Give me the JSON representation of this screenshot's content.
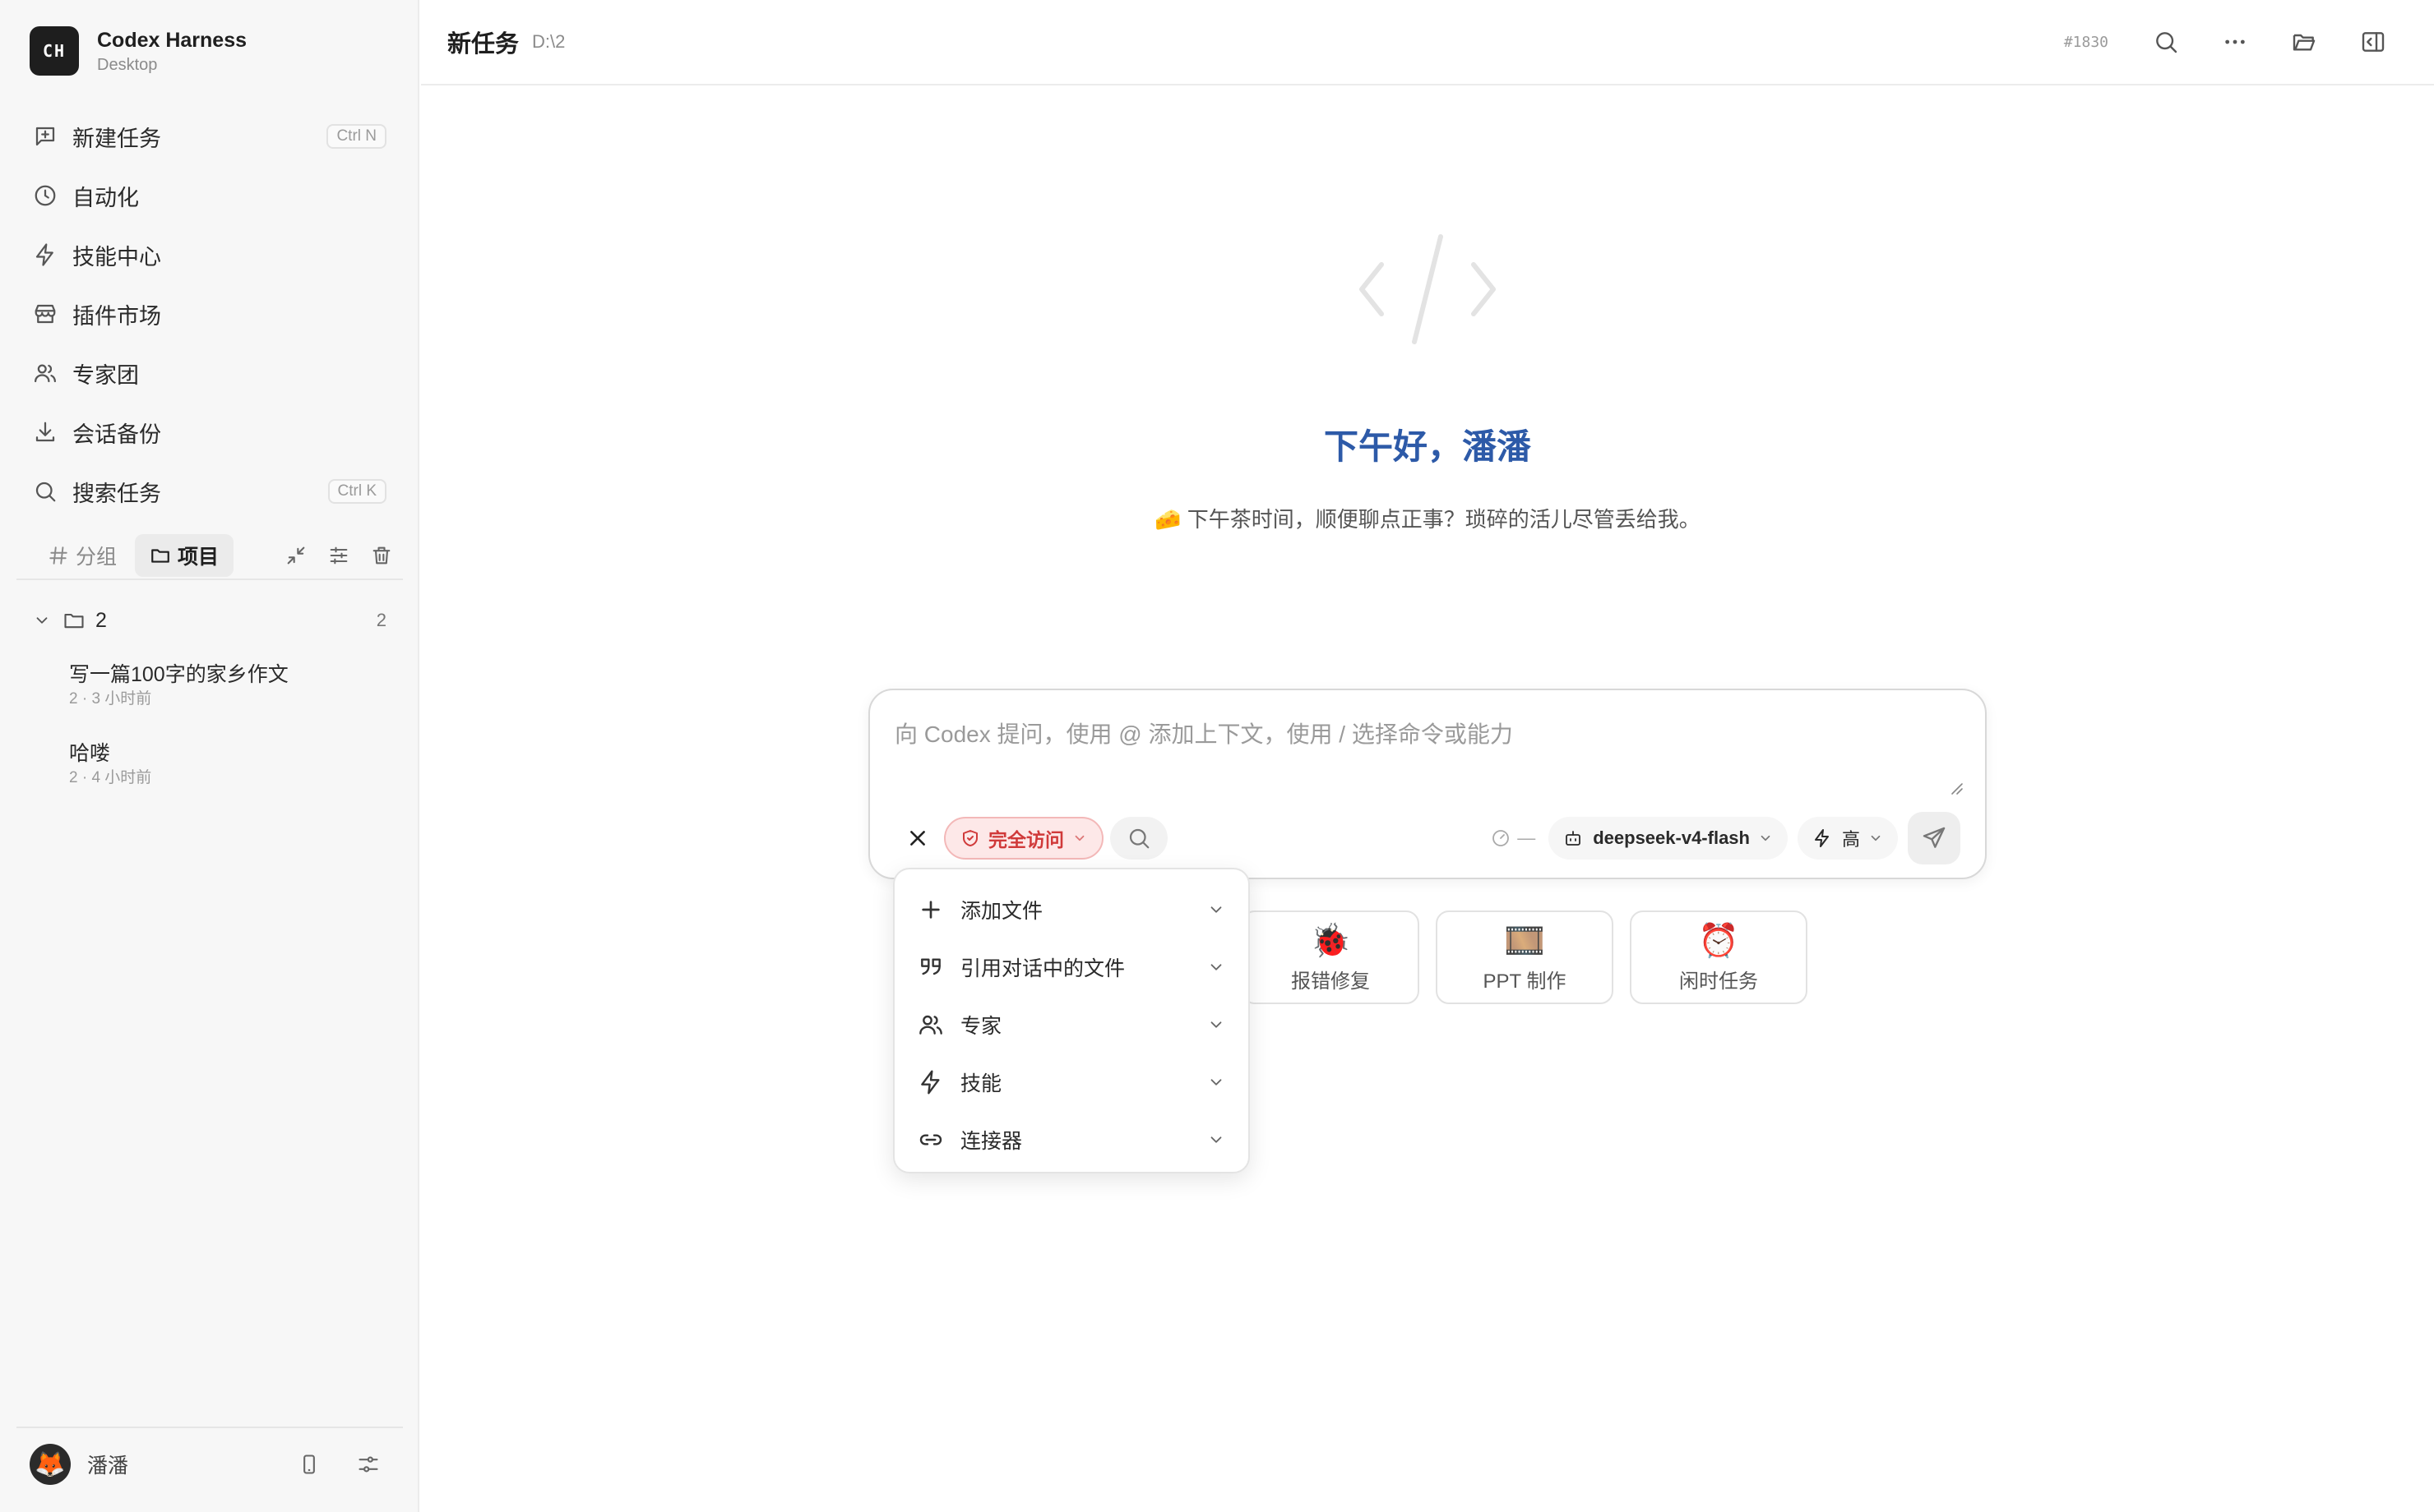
{
  "brand": {
    "logo": "CH",
    "title": "Codex Harness",
    "subtitle": "Desktop"
  },
  "nav": {
    "new_task": {
      "label": "新建任务",
      "shortcut": "Ctrl N",
      "icon": "new-task-icon"
    },
    "automation": {
      "label": "自动化",
      "icon": "clock-icon"
    },
    "skills": {
      "label": "技能中心",
      "icon": "lightning-icon"
    },
    "plugins": {
      "label": "插件市场",
      "icon": "store-icon"
    },
    "experts": {
      "label": "专家团",
      "icon": "users-icon"
    },
    "backup": {
      "label": "会话备份",
      "icon": "download-icon"
    },
    "search": {
      "label": "搜索任务",
      "shortcut": "Ctrl K",
      "icon": "search-icon"
    }
  },
  "tabs": {
    "group": "分组",
    "project": "项目"
  },
  "project": {
    "name": "2",
    "count": "2"
  },
  "tasks": [
    {
      "title": "写一篇100字的家乡作文",
      "meta": "2 · 3 小时前"
    },
    {
      "title": "哈喽",
      "meta": "2 · 4 小时前"
    }
  ],
  "user": {
    "name": "潘潘",
    "avatar": "🦊"
  },
  "header": {
    "title": "新任务",
    "path": "D:\\2",
    "id": "#1830"
  },
  "hero": {
    "greeting": "下午好，潘潘",
    "subtitle": "🧀 下午茶时间，顺便聊点正事？琐碎的活儿尽管丢给我。"
  },
  "composer": {
    "placeholder": "向 Codex 提问，使用 @ 添加上下文，使用 / 选择命令或能力",
    "access_label": "完全访问",
    "context_meter": "—",
    "model": "deepseek-v4-flash",
    "effort": "高",
    "access_color": "#d03a3a"
  },
  "quick_cards": [
    {
      "emoji": "🐞",
      "label": "报错修复"
    },
    {
      "emoji": "🎞️",
      "label": "PPT 制作"
    },
    {
      "emoji": "⏰",
      "label": "闲时任务"
    }
  ],
  "menu": [
    {
      "label": "添加文件",
      "icon": "plus-icon"
    },
    {
      "label": "引用对话中的文件",
      "icon": "quote-icon"
    },
    {
      "label": "专家",
      "icon": "users-icon"
    },
    {
      "label": "技能",
      "icon": "lightning-icon"
    },
    {
      "label": "连接器",
      "icon": "link-icon"
    }
  ],
  "colors": {
    "accent": "#2d5aa8",
    "danger": "#d03a3a",
    "sidebar_bg": "#f7f7f7"
  }
}
